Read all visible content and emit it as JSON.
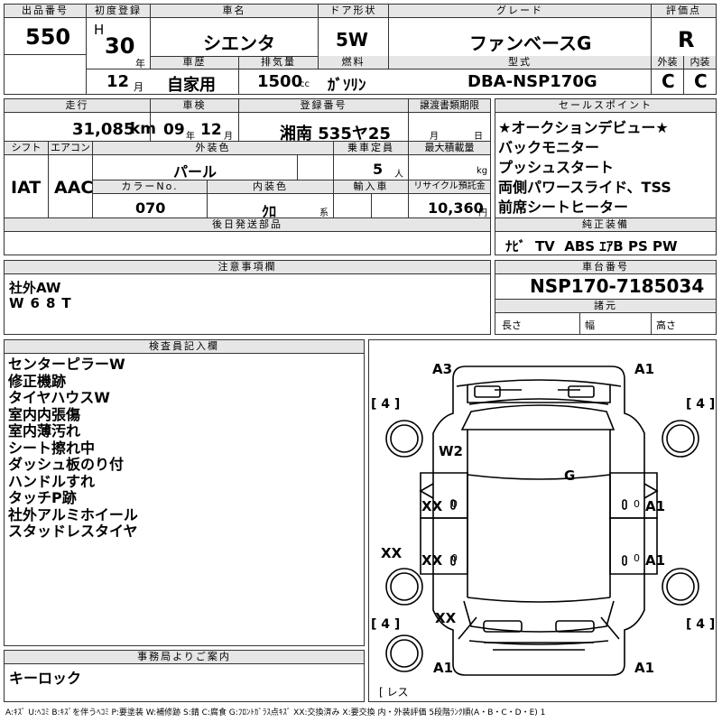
{
  "header": {
    "lot_label": "出品番号",
    "lot_value": "550",
    "first_reg_label": "初度登録",
    "era": "H",
    "first_reg_year": "30",
    "year_suffix": "年",
    "first_reg_month": "12",
    "month_suffix": "月",
    "car_name_label": "車名",
    "car_name": "シエンタ",
    "door_label": "ドア形状",
    "door": "5W",
    "grade_label": "グレード",
    "grade": "ファンベースG",
    "score_label": "評価点",
    "score": "R",
    "history_label": "車歴",
    "history": "自家用",
    "displacement_label": "排気量",
    "displacement": "1500",
    "displacement_unit": "cc",
    "fuel_label": "燃料",
    "fuel": "ｶﾞｿﾘﾝ",
    "model_label": "型式",
    "model": "DBA-NSP170G",
    "exterior_label": "外装",
    "exterior": "C",
    "interior_label": "内装",
    "interior": "C"
  },
  "row2": {
    "mileage_label": "走行",
    "mileage": "31,085",
    "mileage_unit": "km",
    "inspection_label": "車検",
    "insp_year": "09",
    "insp_month": "12",
    "year_suffix": "年",
    "month_suffix": "月",
    "plate_label": "登録番号",
    "plate": "湘南 535ヤ25",
    "transfer_label": "譲渡書類期限",
    "transfer_month": "月",
    "transfer_day": "日"
  },
  "row3": {
    "shift_label": "シフト",
    "shift": "IAT",
    "ac_label": "エアコン",
    "ac": "AAC",
    "color_label": "外装色",
    "color": "パール",
    "capacity_label": "乗車定員",
    "capacity": "5",
    "capacity_unit": "人",
    "max_load_label": "最大積載量",
    "max_load_unit": "kg",
    "color_no_label": "カラーNo.",
    "color_no": "070",
    "int_color_label": "内装色",
    "int_color": "ｸﾛ",
    "int_color_suffix": "系",
    "import_label": "輸入車",
    "recycle_label": "リサイクル預託金",
    "recycle": "10,360",
    "recycle_unit": "円",
    "later_parts_label": "後日発送部品"
  },
  "sales_points": {
    "label": "セールスポイント",
    "items": [
      "★オークションデビュー★",
      "バックモニター",
      "プッシュスタート",
      "両側パワースライド、TSS",
      "前席シートヒーター"
    ]
  },
  "equipment": {
    "label": "純正装備",
    "value": "ﾅﾋﾞ  TV  ABS ｴｱB PS PW"
  },
  "notes": {
    "label": "注意事項欄",
    "lines": [
      "社外AW",
      "W68T"
    ]
  },
  "chassis": {
    "label": "車台番号",
    "value": "NSP170-7185034",
    "specs_label": "諸元",
    "length": "長さ",
    "width": "幅",
    "height": "高さ"
  },
  "inspector": {
    "label": "検査員記入欄",
    "items": [
      "センターピラーW",
      "修正機跡",
      "タイヤハウスW",
      "室内内張傷",
      "室内薄汚れ",
      "シート擦れ中",
      "ダッシュ板のり付",
      "ハンドルすれ",
      "タッチP跡",
      "社外アルミホイール",
      "スタッドレスタイヤ"
    ]
  },
  "office": {
    "label": "事務局よりご案内",
    "text": "キーロック"
  },
  "diagram": {
    "a3": "A3",
    "a1_tr": "A1",
    "w2": "W2",
    "g": "G",
    "xx_l1": "XX",
    "a1_r1": "A1",
    "xx_left": "XX",
    "xx_l2": "XX",
    "a1_r2": "A1",
    "xx_l3": "XX",
    "a1_bl": "A1",
    "a1_br": "A1",
    "tire": "4",
    "zero": "0",
    "lens": "レス"
  },
  "legend": "A:ｷｽﾞ U:ﾍｺﾐ B:ｷｽﾞを伴うﾍｺﾐ P:要塗装 W:補修跡 S:錆 C:腐食 G:ﾌﾛﾝﾄｶﾞﾗｽ点ｷｽﾞ XX:交換済み X:要交換 内・外装評価 5段階ﾗﾝｸ順(A・B・C・D・E) 1"
}
